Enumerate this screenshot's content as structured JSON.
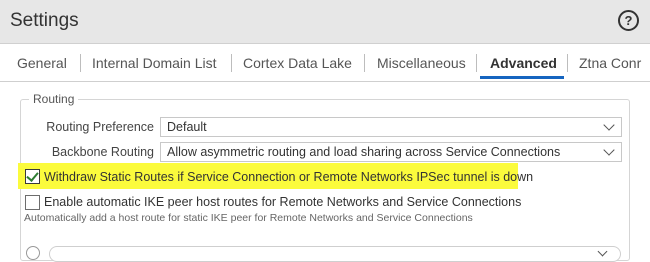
{
  "header": {
    "title": "Settings",
    "help_icon": "?"
  },
  "tabs": [
    {
      "label": "General"
    },
    {
      "label": "Internal Domain List"
    },
    {
      "label": "Cortex Data Lake"
    },
    {
      "label": "Miscellaneous"
    },
    {
      "label": "Advanced",
      "active": true
    },
    {
      "label": "Ztna Conr"
    }
  ],
  "routing": {
    "legend": "Routing",
    "routing_preference": {
      "label": "Routing Preference",
      "value": "Default"
    },
    "backbone_routing": {
      "label": "Backbone Routing",
      "value": "Allow asymmetric routing and load sharing across Service Connections"
    },
    "withdraw_static": {
      "label": "Withdraw Static Routes if Service Connection or Remote Networks IPSec tunnel is down",
      "checked": true
    },
    "ike_peer": {
      "label": "Enable automatic IKE peer host routes for Remote Networks and Service Connections",
      "checked": false,
      "hint": "Automatically add a host route for static IKE peer for Remote Networks and Service Connections"
    }
  },
  "colors": {
    "highlight": "#fbfb3c",
    "active_tab_underline": "#1565c0",
    "check": "#2e7d32"
  }
}
